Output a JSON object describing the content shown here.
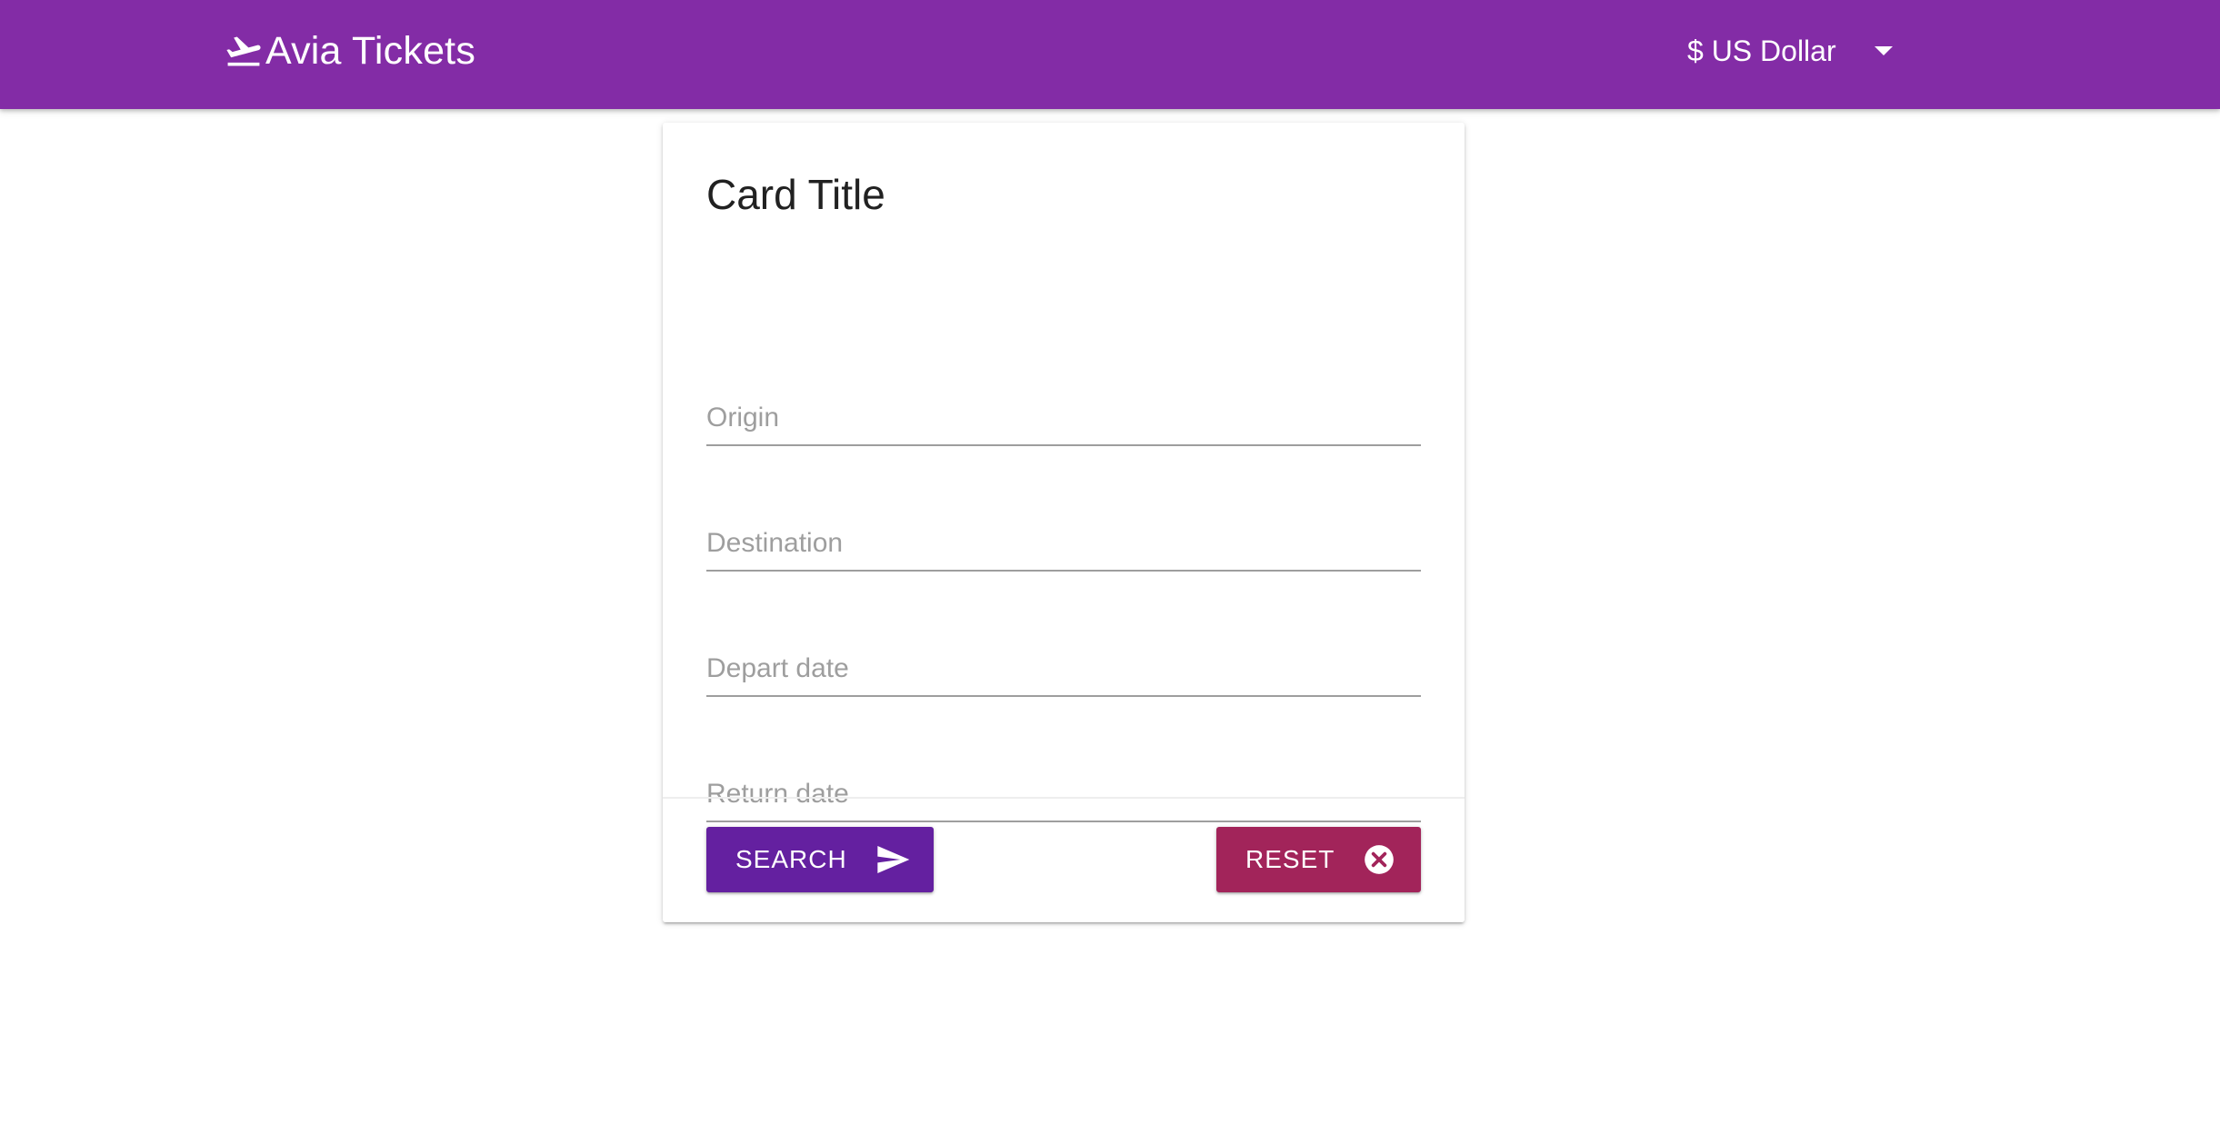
{
  "navbar": {
    "brand_text": "Avia Tickets",
    "brand_icon": "flight-takeoff-icon",
    "currency_label": "$ US Dollar",
    "currency_caret_icon": "caret-down-icon"
  },
  "card": {
    "title": "Card Title",
    "fields": {
      "origin_placeholder": "Origin",
      "destination_placeholder": "Destination",
      "depart_placeholder": "Depart date",
      "return_placeholder": "Return date",
      "origin_value": "",
      "destination_value": "",
      "depart_value": "",
      "return_value": ""
    },
    "actions": {
      "search_label": "SEARCH",
      "search_icon": "send-icon",
      "reset_label": "RESET",
      "reset_icon": "cancel-circle-icon"
    }
  },
  "colors": {
    "navbar": "#832ca6",
    "search_button": "#6420a0",
    "reset_button": "#a2245a"
  }
}
